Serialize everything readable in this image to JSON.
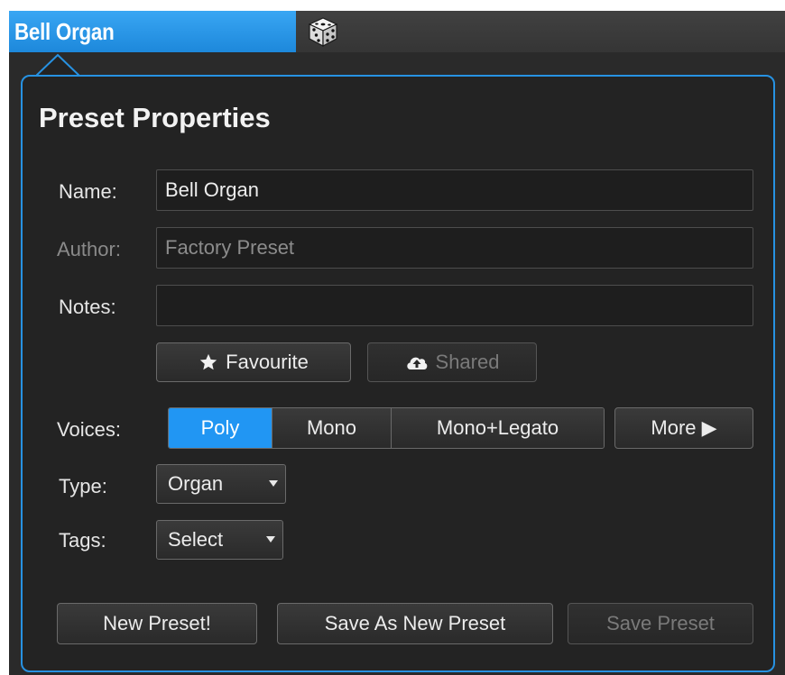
{
  "header": {
    "preset_name": "Bell Organ",
    "randomize_icon": "dice-icon",
    "tab_color": "#2196f3"
  },
  "panel": {
    "title": "Preset Properties",
    "border_color": "#2792e2"
  },
  "form": {
    "name_label": "Name:",
    "name_value": "Bell Organ",
    "author_label": "Author:",
    "author_value": "Factory Preset",
    "notes_label": "Notes:",
    "notes_value": ""
  },
  "flags": {
    "favourite_label": "Favourite",
    "favourite_icon": "star-icon",
    "shared_label": "Shared",
    "shared_icon": "cloud-upload-icon"
  },
  "voices": {
    "label": "Voices:",
    "options": [
      "Poly",
      "Mono",
      "Mono+Legato"
    ],
    "selected": "Poly",
    "more_label": "More ▶"
  },
  "type": {
    "label": "Type:",
    "selected": "Organ"
  },
  "tags": {
    "label": "Tags:",
    "selected": "Select"
  },
  "actions": {
    "new_preset": "New Preset!",
    "save_as_new": "Save As New Preset",
    "save": "Save Preset"
  }
}
